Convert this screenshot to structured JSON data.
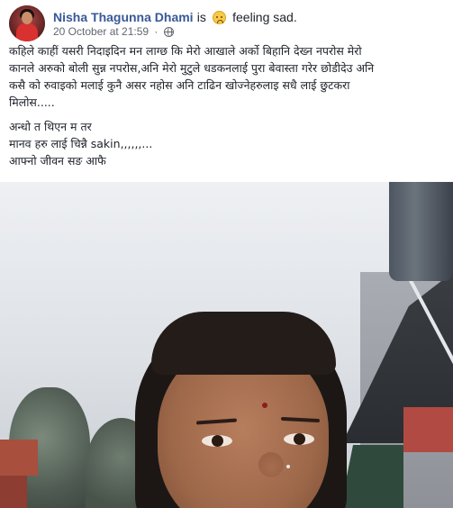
{
  "post": {
    "author": "Nisha Thagunna Dhami",
    "is_text": "is",
    "feeling_text": "feeling sad.",
    "timestamp": "20 October at 21:59",
    "separator": "·",
    "privacy_icon": "globe-icon",
    "feeling_icon": "sad-emoji-icon",
    "body": {
      "paragraph1": [
        "कहिले काहीं यसरी निदाइदिन मन लाग्छ कि मेरो आखाले अर्को बिहानि देख्न नपरोस मेरो",
        "कानले अरुको बोली सुन्न नपरोस,अनि मेरो मुटुले धडकनलाई पुरा बेवास्ता गरेर छोडीदेउ अनि",
        "कसै को रुवाइको मलाई कुनै असर नहोस अनि टाढिन खोज्नेहरुलाइ सधै लाई छुटकरा",
        "मिलोस....."
      ],
      "paragraph2": [
        "अन्धो त थिएन म तर",
        "मानव हरु लाई चिन्नै sakin,,,,,,...",
        "आफ्नो जीवन सङ आफै"
      ]
    }
  },
  "colors": {
    "name_link": "#385898",
    "meta_text": "#616770",
    "body_text": "#1d2129"
  }
}
